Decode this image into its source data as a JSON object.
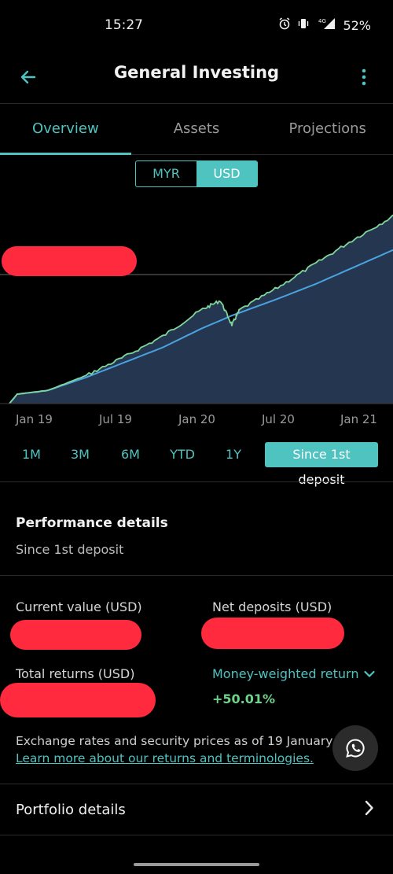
{
  "status_bar": {
    "time": "15:27",
    "network": "4G",
    "battery": "52%",
    "icons": [
      "alarm-icon",
      "vibrate-icon",
      "signal-icon",
      "battery-icon"
    ]
  },
  "header": {
    "title": "General Investing",
    "back_icon": "arrow-left-icon",
    "menu_icon": "more-vertical-icon"
  },
  "tabs": [
    {
      "label": "Overview",
      "active": true
    },
    {
      "label": "Assets",
      "active": false
    },
    {
      "label": "Projections",
      "active": false
    }
  ],
  "currency": {
    "options": [
      "MYR",
      "USD"
    ],
    "selected": "USD"
  },
  "colors": {
    "accent": "#4fc3c0",
    "value_line": "#7fd69a",
    "deposit_line": "#4aa3e0",
    "area_fill": "#253650",
    "redaction": "#ff2a3d",
    "positive": "#6fd38b"
  },
  "chart_data": {
    "type": "area",
    "x_tick_labels": [
      "Jan 19",
      "Jul 19",
      "Jan 20",
      "Jul 20",
      "Jan 21"
    ],
    "series": [
      {
        "key": "value",
        "points": [
          [
            0,
            0
          ],
          [
            0.02,
            0.05
          ],
          [
            0.1,
            0.07
          ],
          [
            0.2,
            0.15
          ],
          [
            0.3,
            0.25
          ],
          [
            0.4,
            0.36
          ],
          [
            0.5,
            0.5
          ],
          [
            0.55,
            0.55
          ],
          [
            0.58,
            0.42
          ],
          [
            0.6,
            0.5
          ],
          [
            0.7,
            0.62
          ],
          [
            0.8,
            0.75
          ],
          [
            0.9,
            0.88
          ],
          [
            1.0,
            1.0
          ]
        ]
      },
      {
        "key": "net_deposits",
        "points": [
          [
            0,
            0
          ],
          [
            0.02,
            0.05
          ],
          [
            0.1,
            0.07
          ],
          [
            0.2,
            0.14
          ],
          [
            0.3,
            0.22
          ],
          [
            0.4,
            0.3
          ],
          [
            0.5,
            0.4
          ],
          [
            0.58,
            0.47
          ],
          [
            0.7,
            0.56
          ],
          [
            0.8,
            0.64
          ],
          [
            0.9,
            0.73
          ],
          [
            1.0,
            0.82
          ]
        ]
      }
    ],
    "grid": false
  },
  "ranges": [
    {
      "label": "1M",
      "active": false
    },
    {
      "label": "3M",
      "active": false
    },
    {
      "label": "6M",
      "active": false
    },
    {
      "label": "YTD",
      "active": false
    },
    {
      "label": "1Y",
      "active": false
    },
    {
      "label": "Since 1st deposit",
      "active": true
    }
  ],
  "performance": {
    "title": "Performance details",
    "subtitle": "Since 1st deposit",
    "current_value_label": "Current value (USD)",
    "net_deposits_label": "Net deposits (USD)",
    "total_returns_label": "Total returns (USD)",
    "return_type_label": "Money-weighted return",
    "return_value": "+50.01%",
    "note": "Exchange rates and security prices as of 19 January 2",
    "link": "Learn more about our returns and terminologies."
  },
  "portfolio": {
    "label": "Portfolio details"
  }
}
